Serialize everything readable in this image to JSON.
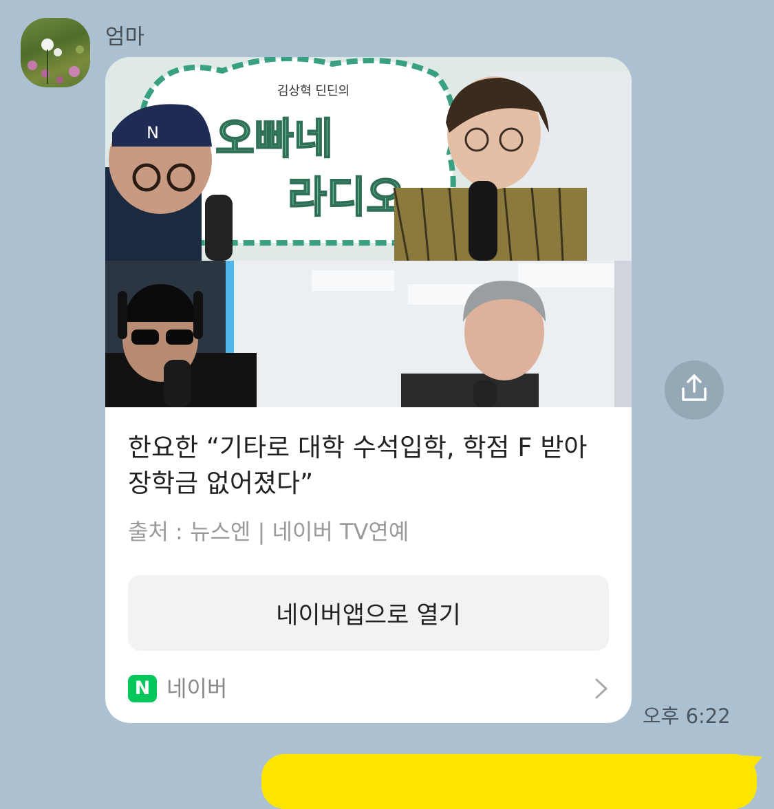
{
  "sender": {
    "name": "엄마"
  },
  "message": {
    "headline": "한요한 “기타로 대학 수석입학, 학점 F 받아 장학금 없어졌다”",
    "source": "출처 : 뉴스엔 | 네이버 TV연예",
    "open_button_label": "네이버앱으로 열기",
    "footer": {
      "logo_letter": "N",
      "label": "네이버"
    },
    "time": "오후 6:22"
  },
  "thumbnail": {
    "show_title_1": "김상혁 딘딘의",
    "show_title_2": "오빠네",
    "show_title_3": "라디오"
  },
  "colors": {
    "chat_background": "#abc1d1",
    "card": "#ffffff",
    "button": "#f2f2f2",
    "naver_green": "#03c75a",
    "my_bubble": "#fee500",
    "share_button": "#94a8b6"
  },
  "icons": {
    "share": "share-icon",
    "chevron": "chevron-right-icon",
    "naver": "naver-logo-icon"
  }
}
